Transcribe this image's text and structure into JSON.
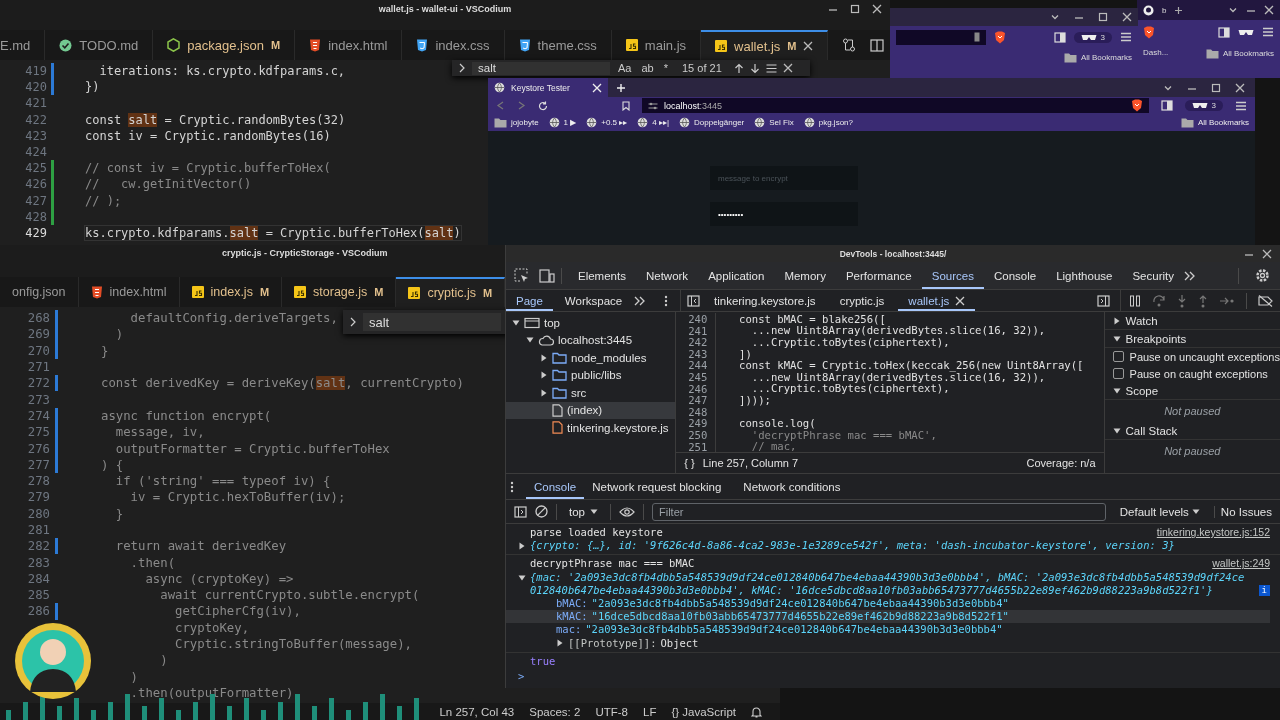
{
  "top_editor": {
    "title": "wallet.js - wallet-ui - VSCodium",
    "tabs": [
      {
        "label": "E.md",
        "selected": false
      },
      {
        "label": "TODO.md",
        "kind": "todo",
        "selected": false
      },
      {
        "label": "package.json",
        "kind": "npm",
        "badge": "M",
        "selected": false
      },
      {
        "label": "index.html",
        "kind": "html",
        "selected": false
      },
      {
        "label": "index.css",
        "kind": "css",
        "selected": false
      },
      {
        "label": "theme.css",
        "kind": "css",
        "selected": false
      },
      {
        "label": "main.js",
        "kind": "js",
        "selected": false
      },
      {
        "label": "wallet.js",
        "kind": "js",
        "badge": "M",
        "selected": true
      }
    ],
    "find": {
      "query": "salt",
      "options": [
        "Aa",
        "ab",
        "*"
      ],
      "count": "15 of 21"
    },
    "lines": [
      {
        "number": "419",
        "color": "#2c7ad6",
        "current": false,
        "kind": "code",
        "text": "  iterations: ks.crypto.kdfparams.c,"
      },
      {
        "number": "420",
        "color": "#2c7ad6",
        "current": false,
        "kind": "code",
        "text": "})"
      },
      {
        "number": "421",
        "current": false
      },
      {
        "number": "422",
        "current": false,
        "kind": "code",
        "text": "const **salt** = Cryptic.randomBytes(32)"
      },
      {
        "number": "423",
        "current": false,
        "kind": "code",
        "text": "const iv = Cryptic.randomBytes(16)"
      },
      {
        "number": "424",
        "current": false
      },
      {
        "number": "425",
        "color": "#2ea043",
        "current": false,
        "kind": "comment",
        "text": "// const iv = Cryptic.bufferToHex("
      },
      {
        "number": "426",
        "color": "#2ea043",
        "current": false,
        "kind": "comment",
        "text": "//   cw.getInitVector()"
      },
      {
        "number": "427",
        "color": "#2ea043",
        "current": false,
        "kind": "comment",
        "text": "// );"
      },
      {
        "number": "428",
        "color": "#2ea043",
        "current": false
      },
      {
        "number": "429",
        "current": true,
        "kind": "code",
        "text": "ks.crypto.kdfparams.**salt** = Cryptic.bufferToHex(**salt**)"
      }
    ]
  },
  "background_browsers": [
    {
      "tab_title": "b",
      "bookmark": "Dash...",
      "all_bookmarks": "All Bookmarks"
    },
    {
      "shields_count": "3",
      "all_bookmarks": "All Bookmarks"
    }
  ],
  "browser": {
    "tab_title": "Keystore Tester",
    "url": {
      "host": "localhost",
      "port": ":3445"
    },
    "shields_count": "3",
    "bookmarks": [
      {
        "label": "jojobyte",
        "kind": "folder"
      },
      {
        "label": "1 ▶",
        "kind": "link"
      },
      {
        "label": "+0.5 ▸▸",
        "kind": "link"
      },
      {
        "label": "4 ▸▸|",
        "kind": "link"
      },
      {
        "label": "Doppelgänger",
        "kind": "link"
      },
      {
        "label": "Sel Fix",
        "kind": "link"
      },
      {
        "label": "pkg.json?",
        "kind": "link"
      }
    ],
    "all_bookmarks": "All Bookmarks",
    "fields": [
      {
        "placeholder": "message to encrypt"
      },
      {
        "value": "•••••••••"
      }
    ]
  },
  "bottom_editor": {
    "title": "cryptic.js - CrypticStorage - VSCodium",
    "tabs": [
      {
        "label": "onfig.json",
        "selected": false
      },
      {
        "label": "index.html",
        "kind": "html",
        "selected": false
      },
      {
        "label": "index.js",
        "kind": "js",
        "badge": "M",
        "selected": false
      },
      {
        "label": "storage.js",
        "kind": "js",
        "badge": "M",
        "selected": false
      },
      {
        "label": "cryptic.js",
        "kind": "js",
        "badge": "M",
        "selected": true
      }
    ],
    "find": {
      "query": "salt"
    },
    "lines": [
      {
        "number": "268",
        "color": "#2c7ad6",
        "text": "    defaultConfig.deriveTargets,"
      },
      {
        "number": "269",
        "color": "#2c7ad6",
        "text": "  )"
      },
      {
        "number": "270",
        "color": "#2c7ad6",
        "text": "}"
      },
      {
        "number": "271"
      },
      {
        "number": "272",
        "color": "#2c7ad6",
        "text": "const derivedKey = deriveKey(**salt**, currentCrypto)"
      },
      {
        "number": "273"
      },
      {
        "number": "274",
        "color": "#2c7ad6",
        "text": "async function encrypt("
      },
      {
        "number": "275",
        "color": "#2c7ad6",
        "text": "  message, iv,"
      },
      {
        "number": "276",
        "color": "#2c7ad6",
        "text": "  outputFormatter = Cryptic.bufferToHex"
      },
      {
        "number": "277",
        "color": "#2c7ad6",
        "text": ") {"
      },
      {
        "number": "278",
        "text": "  if ('string' === typeof iv) {"
      },
      {
        "number": "279",
        "text": "    iv = Cryptic.hexToBuffer(iv);"
      },
      {
        "number": "280",
        "text": "  }"
      },
      {
        "number": "281"
      },
      {
        "number": "282",
        "color": "#2c7ad6",
        "text": "  return await derivedKey"
      },
      {
        "number": "283",
        "text": "    .then("
      },
      {
        "number": "284",
        "text": "      async (cryptoKey) =>"
      },
      {
        "number": "285",
        "text": "        await currentCrypto.subtle.encrypt("
      },
      {
        "number": "286",
        "color": "#2c7ad6",
        "text": "          getCipherCfg(iv),"
      },
      {
        "text": "          cryptoKey,"
      },
      {
        "text": "          Cryptic.stringToBuffer(message),"
      },
      {
        "text": "        )"
      },
      {
        "text": "    )"
      },
      {
        "text": "    .then(outputFormatter)"
      }
    ],
    "status_bar": [
      "Ln 257, Col 43",
      "Spaces: 2",
      "UTF-8",
      "LF",
      "{} JavaScript"
    ]
  },
  "devtools": {
    "title": "DevTools - localhost:3445/",
    "panels": [
      {
        "label": "Elements",
        "selected": false
      },
      {
        "label": "Network",
        "selected": false
      },
      {
        "label": "Application",
        "selected": false
      },
      {
        "label": "Memory",
        "selected": false
      },
      {
        "label": "Performance",
        "selected": false
      },
      {
        "label": "Sources",
        "selected": true
      },
      {
        "label": "Console",
        "selected": false
      },
      {
        "label": "Lighthouse",
        "selected": false
      },
      {
        "label": "Security",
        "selected": false
      }
    ],
    "nav_tabs": [
      {
        "label": "Page",
        "selected": true
      },
      {
        "label": "Workspace",
        "selected": false
      }
    ],
    "file_tabs": [
      {
        "label": "tinkering.keystore.js",
        "selected": false
      },
      {
        "label": "cryptic.js",
        "selected": false
      },
      {
        "label": "wallet.js",
        "selected": true
      }
    ],
    "tree": [
      {
        "label": "top",
        "kind": "frame",
        "expanded": true,
        "selected": false,
        "children": [
          {
            "label": "localhost:3445",
            "kind": "origin",
            "expanded": true,
            "selected": false,
            "children": [
              {
                "label": "node_modules",
                "kind": "folder",
                "expanded": false,
                "selected": false
              },
              {
                "label": "public/libs",
                "kind": "folder",
                "expanded": false,
                "selected": false
              },
              {
                "label": "src",
                "kind": "folder",
                "expanded": false,
                "selected": false
              },
              {
                "label": "(index)",
                "kind": "document",
                "selected": true
              },
              {
                "label": "tinkering.keystore.js",
                "kind": "script",
                "selected": false
              }
            ]
          }
        ]
      }
    ],
    "code": [
      {
        "number": "240",
        "kind": "code",
        "text": "  const bMAC = blake256(["
      },
      {
        "number": "241",
        "kind": "code",
        "text": "    ...new Uint8Array(derivedBytes.slice(16, 32)),"
      },
      {
        "number": "242",
        "kind": "code",
        "text": "    ...Cryptic.toBytes(ciphertext),"
      },
      {
        "number": "243",
        "kind": "code",
        "text": "  ])"
      },
      {
        "number": "244",
        "kind": "code",
        "text": "  const kMAC = Cryptic.toHex(keccak_256(new Uint8Array(["
      },
      {
        "number": "245",
        "kind": "code",
        "text": "    ...new Uint8Array(derivedBytes.slice(16, 32)),"
      },
      {
        "number": "246",
        "kind": "code",
        "text": "    ...Cryptic.toBytes(ciphertext),"
      },
      {
        "number": "247",
        "kind": "code",
        "text": "  ])));"
      },
      {
        "number": "248"
      },
      {
        "number": "249",
        "kind": "code",
        "text": "  console.log("
      },
      {
        "number": "250",
        "kind": "string",
        "text": "    'decryptPhrase mac === bMAC',"
      },
      {
        "number": "251",
        "kind": "comment",
        "text": "    // mac,"
      }
    ],
    "source_status": {
      "pretty_print": "{ }",
      "position": "Line 257, Column 7",
      "coverage": "Coverage: n/a"
    },
    "debugger": [
      {
        "title": "Watch",
        "expanded": false
      },
      {
        "title": "Breakpoints",
        "expanded": true,
        "checkboxes": [
          {
            "label": "Pause on uncaught exceptions",
            "checked": false
          },
          {
            "label": "Pause on caught exceptions",
            "checked": false
          }
        ]
      },
      {
        "title": "Scope",
        "expanded": true,
        "note": "Not paused"
      },
      {
        "title": "Call Stack",
        "expanded": true,
        "note": "Not paused"
      }
    ],
    "drawer_tabs": [
      {
        "label": "Console",
        "selected": true
      },
      {
        "label": "Network request blocking",
        "selected": false
      },
      {
        "label": "Network conditions",
        "selected": false
      }
    ],
    "console": {
      "context": "top",
      "filter_placeholder": "Filter",
      "levels": "Default levels",
      "issues": "No Issues",
      "prompt": ">",
      "messages": [
        {
          "kind": "log",
          "text": "parse loaded keystore",
          "source": "tinkering.keystore.js:152",
          "object": {
            "expanded": false,
            "preview": "{crypto: {…}, id: '9f626c4d-8a86-4ca2-983e-1e3289ce542f', meta: 'dash-incubator-keystore', version: 3}"
          }
        },
        {
          "kind": "log",
          "text": "decryptPhrase mac === bMAC",
          "source": "wallet.js:249",
          "object": {
            "expanded": true,
            "info": "i",
            "preview": "{mac: '2a093e3dc8fb4dbb5a548539d9df24ce012840b647be4ebaa44390b3d3e0bbb4', bMAC: '2a093e3dc8fb4dbb5a548539d9df24ce012840b647be4ebaa44390b3d3e0bbb4', kMAC: '16dce5dbcd8aa10fb03abb65473777d4655b22e89ef462b9d88223a9b8d522f1'}",
            "properties": [
              {
                "kind": "string",
                "key": "bMAC:",
                "value": "\"2a093e3dc8fb4dbb5a548539d9df24ce012840b647be4ebaa44390b3d3e0bbb4\"",
                "hovered": false
              },
              {
                "kind": "string",
                "key": "kMAC:",
                "value": "\"16dce5dbcd8aa10fb03abb65473777d4655b22e89ef462b9d88223a9b8d522f1\"",
                "hovered": true
              },
              {
                "kind": "string",
                "key": "mac:",
                "value": "\"2a093e3dc8fb4dbb5a548539d9df24ce012840b647be4ebaa44390b3d3e0bbb4\"",
                "hovered": false
              },
              {
                "kind": "prototype",
                "key": "[[Prototype]]:",
                "value": "Object",
                "hovered": false
              }
            ]
          }
        },
        {
          "kind": "value",
          "text": "true"
        }
      ]
    }
  }
}
